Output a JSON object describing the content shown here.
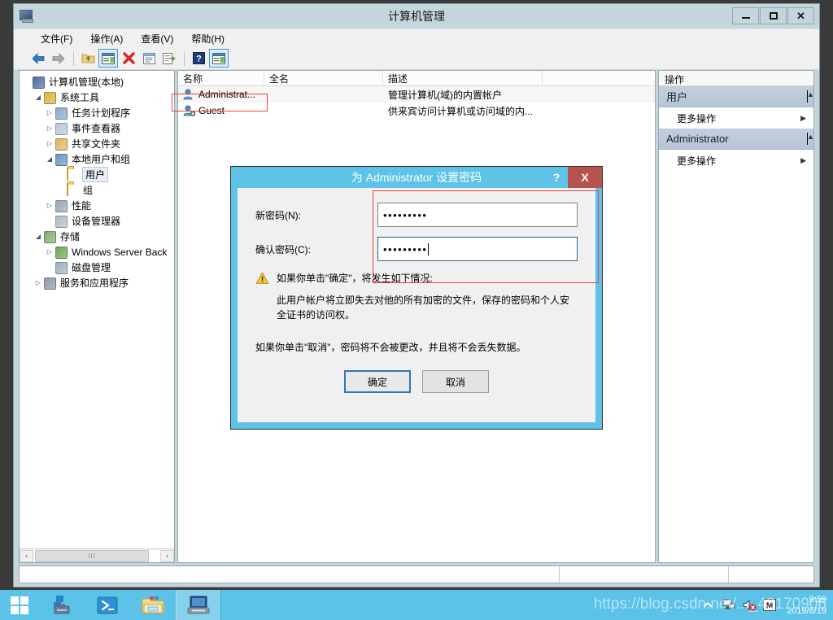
{
  "window": {
    "title": "计算机管理",
    "icon": "computer-management-icon",
    "buttons": {
      "minimize": "—",
      "maximize": "□",
      "close": "✕"
    }
  },
  "menubar": {
    "items": [
      {
        "label": "文件(F)",
        "name": "menu-file"
      },
      {
        "label": "操作(A)",
        "name": "menu-action"
      },
      {
        "label": "查看(V)",
        "name": "menu-view"
      },
      {
        "label": "帮助(H)",
        "name": "menu-help"
      }
    ]
  },
  "toolbar": {
    "buttons": [
      {
        "icon": "back-arrow-icon",
        "selected": false
      },
      {
        "icon": "forward-arrow-icon",
        "selected": false
      },
      {
        "icon": "up-folder-icon",
        "selected": false
      },
      {
        "icon": "properties-icon",
        "selected": true
      },
      {
        "icon": "delete-x-icon",
        "selected": false
      },
      {
        "icon": "refresh-icon",
        "selected": false
      },
      {
        "icon": "export-list-icon",
        "selected": false
      },
      {
        "icon": "help-icon",
        "selected": false
      },
      {
        "icon": "show-hide-pane-icon",
        "selected": true
      }
    ]
  },
  "tree": {
    "nodes": [
      {
        "label": "计算机管理(本地)",
        "indent": 0,
        "twist": "",
        "icon": "computer-icon",
        "color": "#4a6f9e",
        "selected": false
      },
      {
        "label": "系统工具",
        "indent": 1,
        "twist": "▲",
        "icon": "tools-icon",
        "color": "#d8b53f",
        "selected": false
      },
      {
        "label": "任务计划程序",
        "indent": 2,
        "twist": "▶",
        "icon": "clock-icon",
        "color": "#8aa8c8",
        "selected": false
      },
      {
        "label": "事件查看器",
        "indent": 2,
        "twist": "▶",
        "icon": "event-viewer-icon",
        "color": "#b8c7d8",
        "selected": false
      },
      {
        "label": "共享文件夹",
        "indent": 2,
        "twist": "▶",
        "icon": "shared-folders-icon",
        "color": "#e0b75c",
        "selected": false
      },
      {
        "label": "本地用户和组",
        "indent": 2,
        "twist": "▲",
        "icon": "local-users-groups-icon",
        "color": "#6b93c2",
        "selected": false
      },
      {
        "label": "用户",
        "indent": 3,
        "twist": "",
        "icon": "folder-icon",
        "color": "#f5cd6b",
        "selected": true
      },
      {
        "label": "组",
        "indent": 3,
        "twist": "",
        "icon": "folder-icon",
        "color": "#f5cd6b",
        "selected": false
      },
      {
        "label": "性能",
        "indent": 2,
        "twist": "▶",
        "icon": "performance-icon",
        "color": "#9aa6b4",
        "selected": false
      },
      {
        "label": "设备管理器",
        "indent": 2,
        "twist": "",
        "icon": "device-manager-icon",
        "color": "#b0bcc8",
        "selected": false
      },
      {
        "label": "存储",
        "indent": 1,
        "twist": "▲",
        "icon": "storage-icon",
        "color": "#7fae6e",
        "selected": false
      },
      {
        "label": "Windows Server Back",
        "indent": 2,
        "twist": "▶",
        "icon": "backup-icon",
        "color": "#6ba84f",
        "selected": false
      },
      {
        "label": "磁盘管理",
        "indent": 2,
        "twist": "",
        "icon": "disk-management-icon",
        "color": "#9fb0bf",
        "selected": false
      },
      {
        "label": "服务和应用程序",
        "indent": 1,
        "twist": "▶",
        "icon": "services-icon",
        "color": "#8e9aa8",
        "selected": false
      }
    ],
    "hscroll": {
      "left": "‹",
      "right": "›",
      "grip": "III"
    }
  },
  "list": {
    "columns": [
      "名称",
      "全名",
      "描述",
      ""
    ],
    "rows": [
      {
        "name": "Administrat...",
        "fullname": "",
        "description": "管理计算机(域)的内置帐户",
        "icon": "user-admin-icon",
        "annotated": true
      },
      {
        "name": "Guest",
        "fullname": "",
        "description": "供来宾访问计算机或访问域的内...",
        "icon": "user-guest-icon",
        "annotated": false
      }
    ]
  },
  "actions": {
    "header": "操作",
    "groups": [
      {
        "title": "用户",
        "caret": "▲",
        "items": [
          {
            "label": "更多操作",
            "arrow": "▶"
          }
        ]
      },
      {
        "title": "Administrator",
        "caret": "▲",
        "items": [
          {
            "label": "更多操作",
            "arrow": "▶"
          }
        ]
      }
    ]
  },
  "statusbar": {
    "segments": [
      "",
      "",
      ""
    ]
  },
  "dialog": {
    "title": "为 Administrator 设置密码",
    "help_label": "?",
    "close_label": "X",
    "fields": [
      {
        "label": "新密码(N):",
        "value": "•••••••••",
        "focused": false,
        "name": "new-password-input"
      },
      {
        "label": "确认密码(C):",
        "value": "•••••••••",
        "focused": true,
        "name": "confirm-password-input"
      }
    ],
    "warning_icon": "warning-triangle-icon",
    "warning_heading": "如果你单击\"确定\"，将发生如下情况:",
    "warning_body": "此用户帐户将立即失去对他的所有加密的文件，保存的密码和个人安全证书的访问权。",
    "warning_footer": "如果你单击\"取消\"，密码将不会被更改，并且将不会丢失数据。",
    "ok_label": "确定",
    "cancel_label": "取消"
  },
  "taskbar": {
    "start": "windows-logo-icon",
    "apps": [
      {
        "icon": "server-manager-icon",
        "active": false
      },
      {
        "icon": "powershell-icon",
        "active": false
      },
      {
        "icon": "file-explorer-icon",
        "active": false
      },
      {
        "icon": "computer-management-icon",
        "active": true
      }
    ],
    "tray": [
      {
        "icon": "show-hidden-icons-icon"
      },
      {
        "icon": "network-icon"
      },
      {
        "icon": "volume-muted-icon"
      },
      {
        "icon": "input-method-icon"
      }
    ],
    "clock": {
      "time": "9:59",
      "date": "2019/6/19"
    }
  },
  "watermark": {
    "text": "https://blog.csdn.net/..._43170906"
  },
  "colors": {
    "accent_cyan": "#5ec3e6",
    "window_chrome": "#c5d5dc",
    "annotation_red": "#e8443c",
    "close_red": "#b5534c",
    "actions_group": "#b6c5d6"
  }
}
